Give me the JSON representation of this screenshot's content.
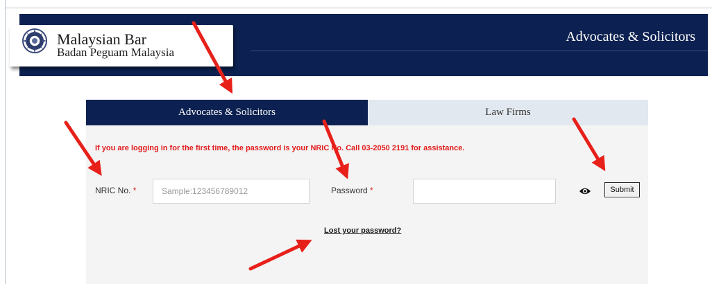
{
  "header": {
    "title": "Advocates & Solicitors"
  },
  "logo": {
    "name": "Malaysian Bar",
    "subtitle": "Badan Peguam Malaysia"
  },
  "tabs": [
    {
      "label": "Advocates & Solicitors",
      "active": true
    },
    {
      "label": "Law Firms",
      "active": false
    }
  ],
  "login": {
    "notice": "If you are logging in for the first time, the password is your NRIC No. Call 03-2050 2191 for assistance.",
    "nric_label": "NRIC No.",
    "nric_placeholder": "Sample:123456789012",
    "nric_value": "",
    "password_label": "Password",
    "password_value": "",
    "required_marker": "*",
    "submit_label": "Submit",
    "lost_password": "Lost your password?"
  },
  "colors": {
    "navy": "#0c2151",
    "tab_inactive": "#e2e8ef",
    "panel": "#f4f4f4",
    "notice_red": "#e31b1b",
    "annotation_red": "#e8201a"
  },
  "icons": {
    "emblem": "malaysian-bar-emblem",
    "password_toggle": "eye-icon",
    "annotation": "red-arrow"
  }
}
